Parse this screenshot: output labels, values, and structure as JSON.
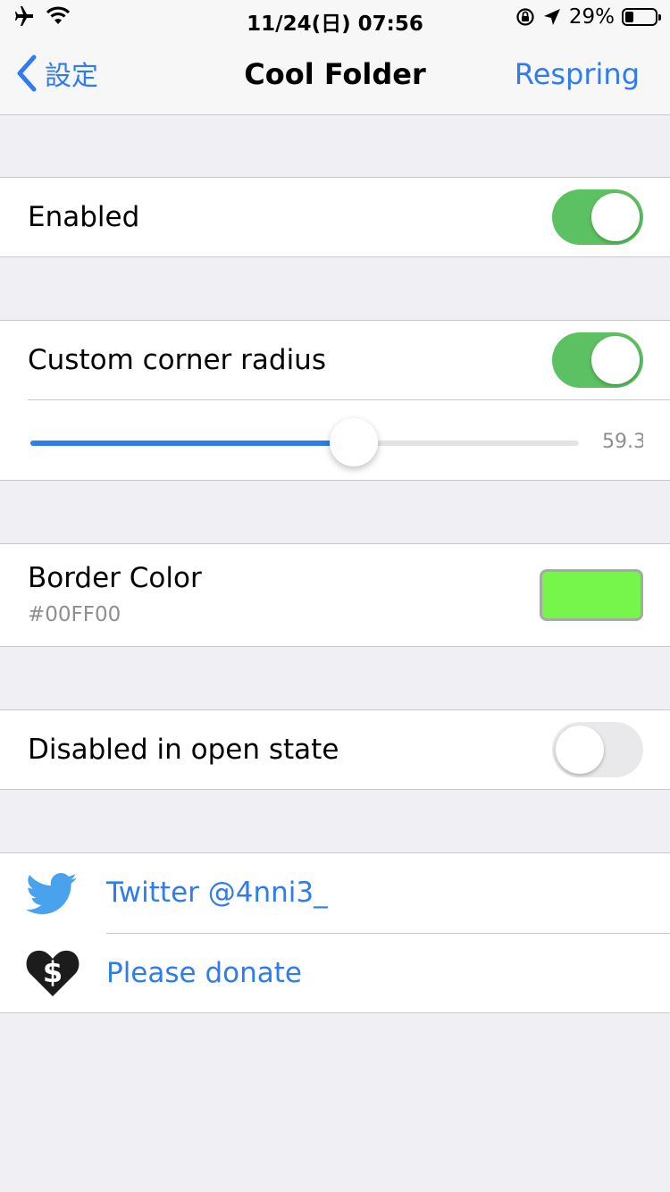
{
  "status_bar": {
    "time": "11/24(日) 07:56",
    "battery_percent": "29%",
    "battery_level": 0.29,
    "icons": [
      "airplane-icon",
      "wifi-icon",
      "rotation-lock-icon",
      "location-icon",
      "battery-icon"
    ]
  },
  "nav": {
    "back_label": "設定",
    "title": "Cool Folder",
    "right_label": "Respring"
  },
  "settings": {
    "enabled": {
      "label": "Enabled",
      "on": true
    },
    "corner_radius": {
      "label": "Custom corner radius",
      "on": true,
      "slider_value": "59.3",
      "slider_fraction": 0.59
    },
    "border_color": {
      "label": "Border Color",
      "value": "#00FF00",
      "swatch_color": "#76f64a"
    },
    "disabled_open": {
      "label": "Disabled in open state",
      "on": false
    }
  },
  "links": [
    {
      "label": "Twitter @4nni3_",
      "icon": "twitter-bird-icon"
    },
    {
      "label": "Please donate",
      "icon": "dollar-heart-icon"
    }
  ],
  "colors": {
    "accent": "#2f7bf0",
    "switch_on": "#5cc163",
    "switch_off": "#e9e9eb",
    "twitter_blue": "#4aa1ec",
    "background": "#efeff4"
  }
}
